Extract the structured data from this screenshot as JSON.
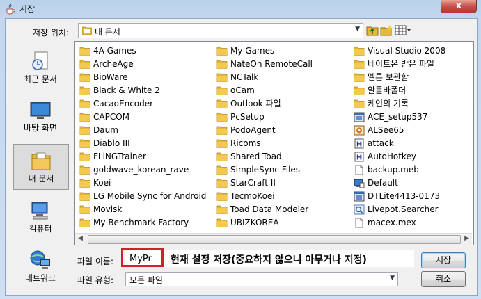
{
  "window": {
    "title": "저장",
    "close_label": "x"
  },
  "location": {
    "label": "저장 위치:",
    "value": "내 문서"
  },
  "places": [
    {
      "label": "최근 문서",
      "icon": "recent-documents-icon"
    },
    {
      "label": "바탕 화면",
      "icon": "desktop-icon"
    },
    {
      "label": "내 문서",
      "icon": "my-documents-icon",
      "selected": true
    },
    {
      "label": "컴퓨터",
      "icon": "computer-icon"
    },
    {
      "label": "네트워크",
      "icon": "network-icon"
    }
  ],
  "files": {
    "col1": [
      {
        "name": "4A Games",
        "type": "folder"
      },
      {
        "name": "ArcheAge",
        "type": "folder"
      },
      {
        "name": "BioWare",
        "type": "folder"
      },
      {
        "name": "Black & White 2",
        "type": "folder"
      },
      {
        "name": "CacaoEncoder",
        "type": "folder"
      },
      {
        "name": "CAPCOM",
        "type": "folder"
      },
      {
        "name": "Daum",
        "type": "folder"
      },
      {
        "name": "Diablo III",
        "type": "folder"
      },
      {
        "name": "FLiNGTrainer",
        "type": "folder"
      },
      {
        "name": "goldwave_korean_rave",
        "type": "folder"
      },
      {
        "name": "Koei",
        "type": "folder"
      },
      {
        "name": "LG Mobile Sync for Android",
        "type": "folder"
      },
      {
        "name": "Movisk",
        "type": "folder"
      },
      {
        "name": "My Benchmark Factory",
        "type": "folder"
      }
    ],
    "col2": [
      {
        "name": "My Games",
        "type": "folder"
      },
      {
        "name": "NateOn RemoteCall",
        "type": "folder"
      },
      {
        "name": "NCTalk",
        "type": "folder"
      },
      {
        "name": "oCam",
        "type": "folder"
      },
      {
        "name": "Outlook 파일",
        "type": "folder"
      },
      {
        "name": "PcSetup",
        "type": "folder"
      },
      {
        "name": "PodoAgent",
        "type": "folder"
      },
      {
        "name": "Ricoms",
        "type": "folder"
      },
      {
        "name": "Shared Toad",
        "type": "folder"
      },
      {
        "name": "SimpleSync Files",
        "type": "folder"
      },
      {
        "name": "StarCraft II",
        "type": "folder"
      },
      {
        "name": "TecmoKoei",
        "type": "folder"
      },
      {
        "name": "Toad Data Modeler",
        "type": "folder"
      },
      {
        "name": "UBIZKOREA",
        "type": "folder"
      }
    ],
    "col3": [
      {
        "name": "Visual Studio 2008",
        "type": "folder"
      },
      {
        "name": "네이트온 받은 파일",
        "type": "folder"
      },
      {
        "name": "멜론 보관함",
        "type": "folder"
      },
      {
        "name": "알툴바폴더",
        "type": "folder"
      },
      {
        "name": "케인의 기록",
        "type": "folder"
      },
      {
        "name": "ACE_setup537",
        "type": "exe"
      },
      {
        "name": "ALSee65",
        "type": "alsee"
      },
      {
        "name": "attack",
        "type": "script"
      },
      {
        "name": "AutoHotkey",
        "type": "script"
      },
      {
        "name": "backup.meb",
        "type": "file"
      },
      {
        "name": "Default",
        "type": "rdp"
      },
      {
        "name": "DTLite4413-0173",
        "type": "exe"
      },
      {
        "name": "Livepot.Searcher",
        "type": "app"
      },
      {
        "name": "macex.mex",
        "type": "file"
      }
    ]
  },
  "filename": {
    "label": "파일 이름:",
    "value": "MyPr"
  },
  "filetype": {
    "label": "파일 유형:",
    "value": "모든 파일"
  },
  "annotation": "현재 설정 저장(중요하지 않으니 아무거나 지정)",
  "buttons": {
    "save": "저장",
    "cancel": "취소"
  },
  "colors": {
    "folder": "#e8b838",
    "highlight_box": "#d0202a",
    "selection_bg": "#dcdcdc"
  }
}
